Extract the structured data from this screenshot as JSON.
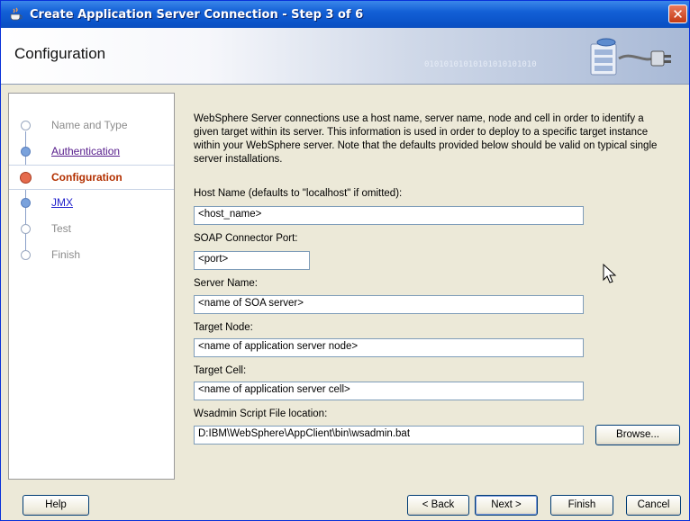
{
  "window": {
    "title": "Create Application Server Connection - Step 3 of 6",
    "close_glyph": "✕"
  },
  "header": {
    "heading": "Configuration",
    "binary_text": "01010101010101010101010",
    "graphic_icon": "server-connection-graphic"
  },
  "nav": {
    "items": [
      {
        "label": "Name and Type",
        "state": "disabled"
      },
      {
        "label": "Authentication",
        "state": "visited"
      },
      {
        "label": "Configuration",
        "state": "current"
      },
      {
        "label": "JMX",
        "state": "link"
      },
      {
        "label": "Test",
        "state": "disabled"
      },
      {
        "label": "Finish",
        "state": "disabled"
      }
    ]
  },
  "main": {
    "intro": "WebSphere Server connections use a host name, server name, node and cell in order to identify a given target within its server. This information is used in order to deploy to a specific target instance within your WebSphere server. Note that the defaults provided below should be valid on typical single server installations.",
    "host_name_label": "Host Name (defaults to \"localhost\" if omitted):",
    "host_name_value": "<host_name>",
    "soap_port_label": "SOAP Connector Port:",
    "soap_port_value": "<port>",
    "server_name_label": "Server Name:",
    "server_name_value": "<name of SOA server>",
    "target_node_label": "Target Node:",
    "target_node_value": "<name of application server node>",
    "target_cell_label": "Target Cell:",
    "target_cell_value": "<name of application server cell>",
    "wsadmin_label": "Wsadmin Script File location:",
    "wsadmin_value": "D:IBM\\WebSphere\\AppClient\\bin\\wsadmin.bat",
    "browse_label": "Browse..."
  },
  "footer": {
    "help": "Help",
    "back": "< Back",
    "next": "Next >",
    "finish": "Finish",
    "cancel": "Cancel"
  },
  "colors": {
    "title_bar": "#0a52c7",
    "current_step": "#b33000",
    "link": "#551a8b"
  }
}
